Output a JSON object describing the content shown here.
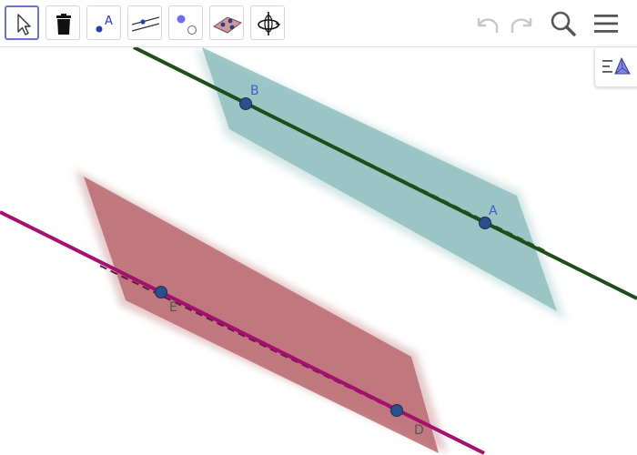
{
  "toolbar": {
    "tools": [
      {
        "name": "move-tool",
        "active": true
      },
      {
        "name": "delete-tool",
        "active": false
      },
      {
        "name": "point-tool",
        "active": false,
        "glyph": "A"
      },
      {
        "name": "line-tool",
        "active": false
      },
      {
        "name": "two-points-tool",
        "active": false
      },
      {
        "name": "plane-tool",
        "active": false
      },
      {
        "name": "rotate-view-tool",
        "active": false
      }
    ],
    "right_icons": [
      "undo-icon",
      "redo-icon",
      "search-icon",
      "menu-icon"
    ]
  },
  "view_panel": {
    "icon": "graphics-view-icon"
  },
  "colors": {
    "accent": "#6e70d8",
    "green_line": "#1f4d1a",
    "magenta_line": "#a3106e",
    "teal_plane": "#8cbcbc",
    "red_plane": "#b86a70",
    "point_fill": "#2a4f8a",
    "label_blue": "#3a5fcf",
    "label_gray": "#555555",
    "disabled_icon": "#c8c8c8"
  },
  "points": [
    {
      "label": "A",
      "color_key": "label_blue"
    },
    {
      "label": "B",
      "color_key": "label_blue"
    },
    {
      "label": "E",
      "color_key": "label_gray"
    },
    {
      "label": "D",
      "color_key": "label_gray"
    }
  ]
}
